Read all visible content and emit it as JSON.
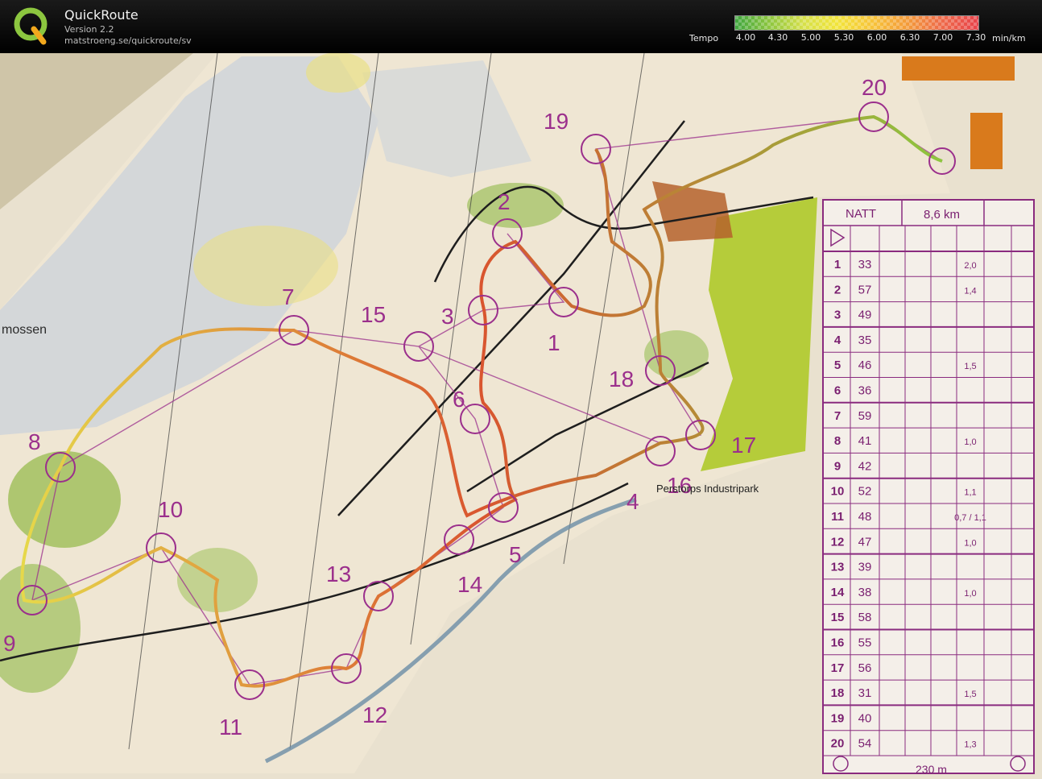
{
  "app": {
    "name": "QuickRoute",
    "version": "Version 2.2",
    "url": "matstroeng.se/quickroute/sv"
  },
  "legend": {
    "label": "Tempo",
    "ticks": [
      "4.00",
      "4.30",
      "5.00",
      "5.30",
      "6.00",
      "6.30",
      "7.00",
      "7.30"
    ],
    "unit": "min/km",
    "colors": [
      "#3fa63f",
      "#8dc63f",
      "#d6e04a",
      "#f2e43a",
      "#f7c23a",
      "#f39a3a",
      "#ee6a4a",
      "#e8424a"
    ]
  },
  "map": {
    "place_labels": [
      "mossen",
      "Perstorps Industripark"
    ],
    "control_numbers": [
      "1",
      "2",
      "3",
      "4",
      "5",
      "6",
      "7",
      "8",
      "9",
      "10",
      "11",
      "12",
      "13",
      "14",
      "15",
      "16",
      "17",
      "18",
      "19",
      "20"
    ]
  },
  "description_sheet": {
    "class": "NATT",
    "length": "8,6 km",
    "footer_distance": "230 m",
    "rows": [
      {
        "num": "1",
        "code": "33",
        "dist": "2,0"
      },
      {
        "num": "2",
        "code": "57",
        "dist": "1,4"
      },
      {
        "num": "3",
        "code": "49",
        "dist": ""
      },
      {
        "num": "4",
        "code": "35",
        "dist": ""
      },
      {
        "num": "5",
        "code": "46",
        "dist": "1,5"
      },
      {
        "num": "6",
        "code": "36",
        "dist": ""
      },
      {
        "num": "7",
        "code": "59",
        "dist": ""
      },
      {
        "num": "8",
        "code": "41",
        "dist": "1,0"
      },
      {
        "num": "9",
        "code": "42",
        "dist": ""
      },
      {
        "num": "10",
        "code": "52",
        "dist": "1,1"
      },
      {
        "num": "11",
        "code": "48",
        "dist": "0,7 / 1,1"
      },
      {
        "num": "12",
        "code": "47",
        "dist": "1,0"
      },
      {
        "num": "13",
        "code": "39",
        "dist": ""
      },
      {
        "num": "14",
        "code": "38",
        "dist": "1,0"
      },
      {
        "num": "15",
        "code": "58",
        "dist": ""
      },
      {
        "num": "16",
        "code": "55",
        "dist": ""
      },
      {
        "num": "17",
        "code": "56",
        "dist": ""
      },
      {
        "num": "18",
        "code": "31",
        "dist": "1,5"
      },
      {
        "num": "19",
        "code": "40",
        "dist": ""
      },
      {
        "num": "20",
        "code": "54",
        "dist": "1,3"
      }
    ]
  }
}
